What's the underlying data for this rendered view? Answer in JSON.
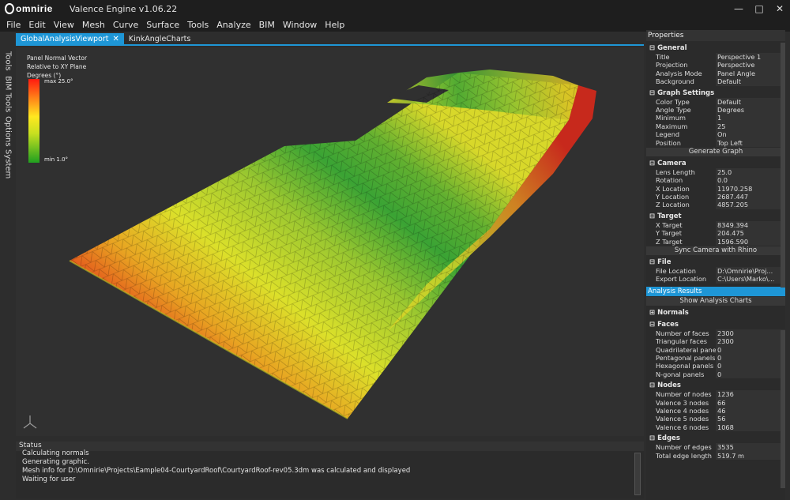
{
  "app": {
    "logo_text": "omnirie",
    "title": "Valence Engine v1.06.22"
  },
  "window_controls": [
    "minimize-icon",
    "maximize-icon",
    "close-icon"
  ],
  "menu": [
    "File",
    "Edit",
    "View",
    "Mesh",
    "Curve",
    "Surface",
    "Tools",
    "Analyze",
    "BIM",
    "Window",
    "Help"
  ],
  "tabs": [
    {
      "label": "GlobalAnalysisViewport",
      "active": true
    },
    {
      "label": "KinkAngleCharts",
      "active": false
    }
  ],
  "side_tabs": [
    "Tools",
    "BIM Tools",
    "Options",
    "System"
  ],
  "legend": {
    "line1": "Panel Normal Vector",
    "line2": "Relative to XY Plane",
    "line3": "Degrees (°)",
    "max": "max 25.0°",
    "min": "min 1.0°"
  },
  "status": {
    "title": "Status",
    "lines": [
      "Calculating normals",
      "Generating graphic.",
      "Mesh info for D:\\Omnirie\\Projects\\Eample04-CourtyardRoof\\CourtyardRoof-rev05.3dm was calculated and displayed",
      "Waiting for user"
    ]
  },
  "properties": {
    "title": "Properties",
    "general": {
      "title": "General",
      "rows": [
        {
          "k": "Title",
          "v": "Perspective 1",
          "dd": false
        },
        {
          "k": "Projection",
          "v": "Perspective",
          "dd": true
        },
        {
          "k": "Analysis Mode",
          "v": "Panel Angle",
          "dd": true
        },
        {
          "k": "Background",
          "v": "Default",
          "dd": true
        }
      ]
    },
    "graph": {
      "title": "Graph Settings",
      "rows": [
        {
          "k": "Color Type",
          "v": "Default",
          "dd": true
        },
        {
          "k": "Angle Type",
          "v": "Degrees",
          "dd": true
        },
        {
          "k": "Minimum",
          "v": "1",
          "dd": false
        },
        {
          "k": "Maximum",
          "v": "25",
          "dd": false
        },
        {
          "k": "Legend",
          "v": "On",
          "dd": true
        },
        {
          "k": "Position",
          "v": "Top Left",
          "dd": true
        }
      ],
      "button": "Generate Graph"
    },
    "camera": {
      "title": "Camera",
      "rows": [
        {
          "k": "Lens Length",
          "v": "25.0"
        },
        {
          "k": "Rotation",
          "v": "0.0"
        },
        {
          "k": "X Location",
          "v": "11970.258"
        },
        {
          "k": "Y Location",
          "v": "2687.447"
        },
        {
          "k": "Z Location",
          "v": "4857.205"
        }
      ]
    },
    "target": {
      "title": "Target",
      "rows": [
        {
          "k": "X Target",
          "v": "8349.394"
        },
        {
          "k": "Y Target",
          "v": "204.475"
        },
        {
          "k": "Z Target",
          "v": "1596.590"
        }
      ],
      "button": "Sync Camera with Rhino"
    },
    "file": {
      "title": "File",
      "rows": [
        {
          "k": "File Location",
          "v": "D:\\Omnirie\\Proj..."
        },
        {
          "k": "Export Location",
          "v": "C:\\Users\\Marko\\..."
        }
      ]
    }
  },
  "results": {
    "title": "Analysis Results",
    "button": "Show Analysis Charts",
    "normals": {
      "title": "Normals"
    },
    "faces": {
      "title": "Faces",
      "rows": [
        {
          "k": "Number of faces",
          "v": "2300"
        },
        {
          "k": "Triangular faces",
          "v": "2300"
        },
        {
          "k": "Quadrilateral panels",
          "v": "0"
        },
        {
          "k": "Pentagonal panels",
          "v": "0"
        },
        {
          "k": "Hexagonal panels",
          "v": "0"
        },
        {
          "k": "N-gonal panels",
          "v": "0"
        }
      ]
    },
    "nodes": {
      "title": "Nodes",
      "rows": [
        {
          "k": "Number of nodes",
          "v": "1236"
        },
        {
          "k": "Valence 3 nodes",
          "v": "66"
        },
        {
          "k": "Valence 4 nodes",
          "v": "46"
        },
        {
          "k": "Valence 5 nodes",
          "v": "56"
        },
        {
          "k": "Valence 6 nodes",
          "v": "1068"
        }
      ]
    },
    "edges": {
      "title": "Edges",
      "rows": [
        {
          "k": "Number of edges",
          "v": "3535"
        },
        {
          "k": "Total edge length",
          "v": "519.7 m"
        }
      ]
    }
  }
}
